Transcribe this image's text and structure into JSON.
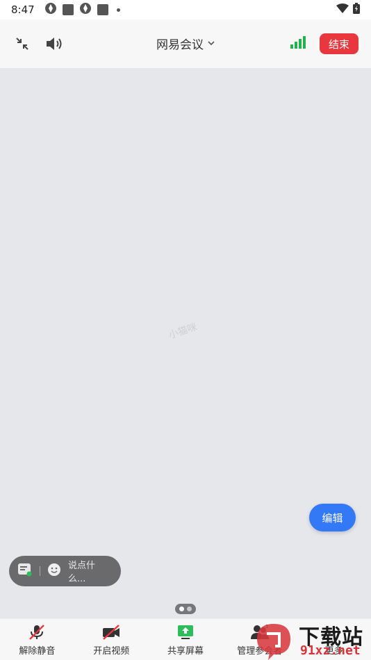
{
  "status_bar": {
    "time": "8:47"
  },
  "top_bar": {
    "title": "网易会议",
    "end_label": "结束"
  },
  "video": {
    "watermark_text": "小猫咪",
    "edit_label": "编辑"
  },
  "chat": {
    "placeholder": "说点什么..."
  },
  "toolbar": {
    "items": [
      {
        "label": "解除静音"
      },
      {
        "label": "开启视频"
      },
      {
        "label": "共享屏幕"
      },
      {
        "label": "管理参会者"
      },
      {
        "label": "更多"
      }
    ]
  },
  "overlay_logo": {
    "big_text": "下载站",
    "small_text": "91xz.net"
  },
  "colors": {
    "end_button": "#e8383d",
    "edit_button": "#3378f6",
    "signal": "#22b14c",
    "share_icon": "#2dbd5a"
  }
}
